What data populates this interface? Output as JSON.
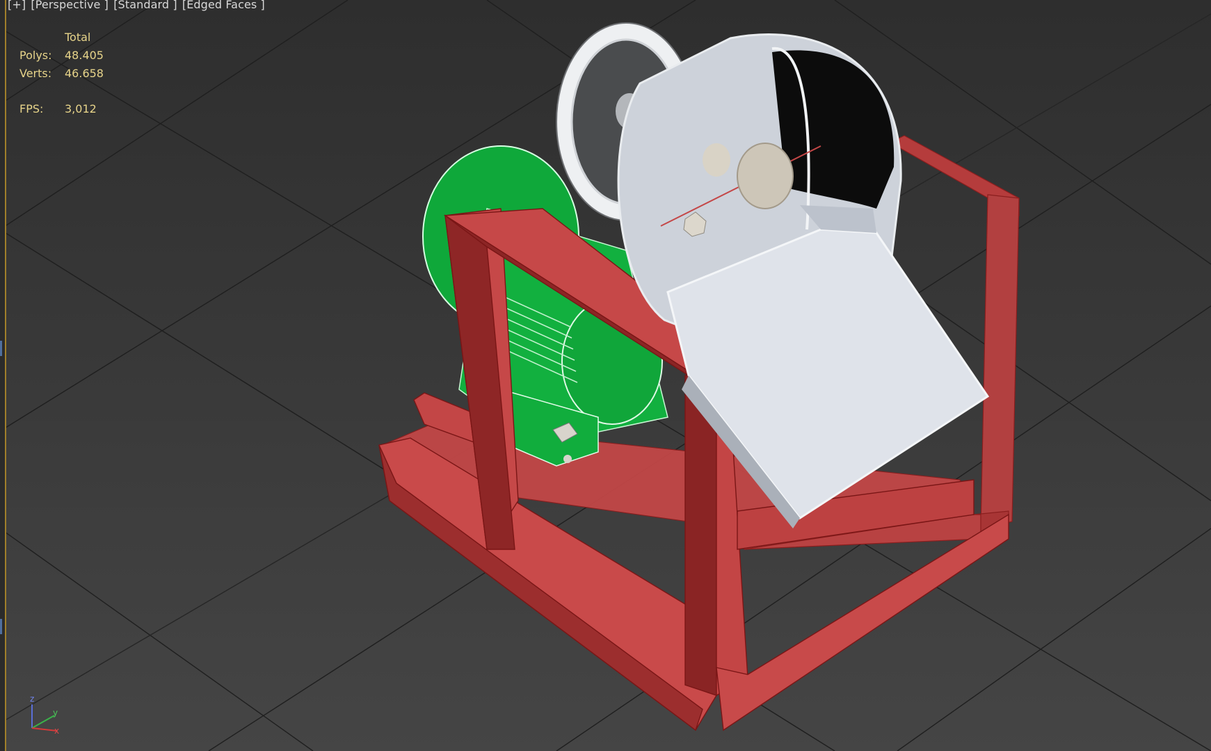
{
  "viewport": {
    "label_parts": [
      "[+]",
      "[Perspective ]",
      "[Standard ]",
      "[Edged Faces ]"
    ],
    "colors": {
      "background_top": "#2e2e2e",
      "background_bottom": "#454545",
      "grid": "#1c1c1c",
      "frame_red": "#c04545",
      "motor_green": "#0fa83a",
      "metal_white": "#d9dde3",
      "stats_text": "#e7d48a",
      "active_border": "#a07f2a"
    }
  },
  "stats": {
    "column_header": "Total",
    "rows": [
      {
        "label": "Polys:",
        "value": "48.405"
      },
      {
        "label": "Verts:",
        "value": "46.658"
      }
    ],
    "fps_label": "FPS:",
    "fps_value": "3,012"
  },
  "axis_gizmo": {
    "z_label": "z",
    "y_label": "y",
    "x_label": "x",
    "icon": "xyz-axis-tripod-icon"
  }
}
